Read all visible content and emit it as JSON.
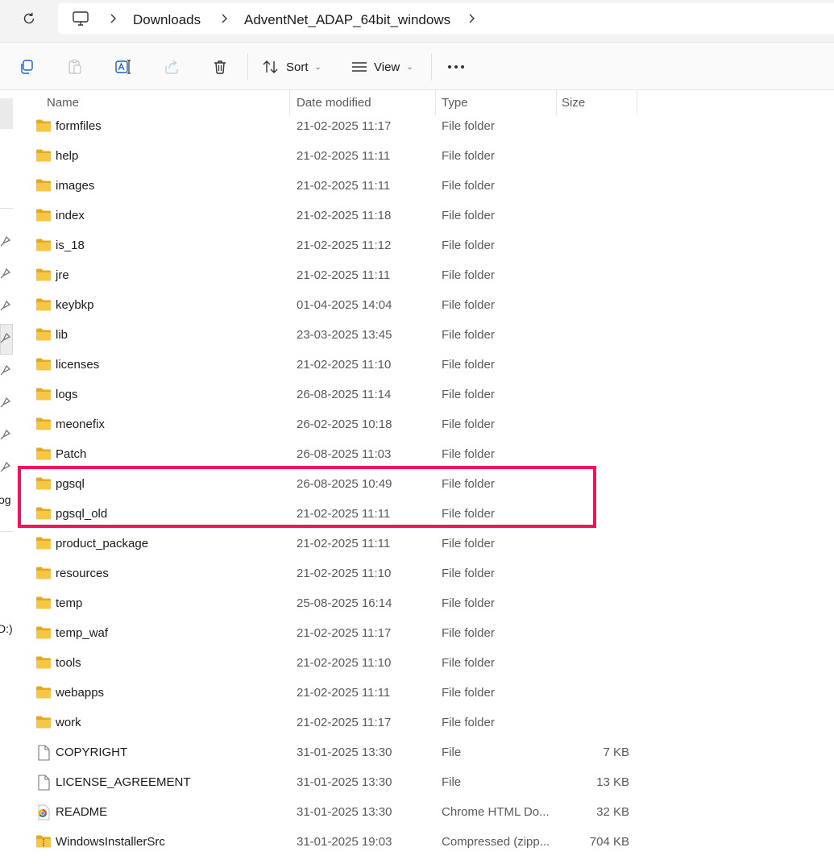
{
  "address_bar": {
    "crumbs": [
      "Downloads",
      "AdventNet_ADAP_64bit_windows"
    ]
  },
  "toolbar": {
    "sort_label": "Sort",
    "view_label": "View",
    "more_label": "•••"
  },
  "left_pane": {
    "partial_text_1": "og",
    "partial_text_2": "D:)"
  },
  "columns": {
    "name": "Name",
    "date": "Date modified",
    "type": "Type",
    "size": "Size"
  },
  "files": [
    {
      "name": "formfiles",
      "date": "21-02-2025 11:17",
      "type": "File folder",
      "size": "",
      "icon": "folder-icon"
    },
    {
      "name": "help",
      "date": "21-02-2025 11:11",
      "type": "File folder",
      "size": "",
      "icon": "folder-icon"
    },
    {
      "name": "images",
      "date": "21-02-2025 11:11",
      "type": "File folder",
      "size": "",
      "icon": "folder-icon"
    },
    {
      "name": "index",
      "date": "21-02-2025 11:18",
      "type": "File folder",
      "size": "",
      "icon": "folder-icon"
    },
    {
      "name": "is_18",
      "date": "21-02-2025 11:12",
      "type": "File folder",
      "size": "",
      "icon": "folder-icon"
    },
    {
      "name": "jre",
      "date": "21-02-2025 11:11",
      "type": "File folder",
      "size": "",
      "icon": "folder-icon"
    },
    {
      "name": "keybkp",
      "date": "01-04-2025 14:04",
      "type": "File folder",
      "size": "",
      "icon": "folder-icon"
    },
    {
      "name": "lib",
      "date": "23-03-2025 13:45",
      "type": "File folder",
      "size": "",
      "icon": "folder-icon"
    },
    {
      "name": "licenses",
      "date": "21-02-2025 11:10",
      "type": "File folder",
      "size": "",
      "icon": "folder-icon"
    },
    {
      "name": "logs",
      "date": "26-08-2025 11:14",
      "type": "File folder",
      "size": "",
      "icon": "folder-icon"
    },
    {
      "name": "meonefix",
      "date": "26-02-2025 10:18",
      "type": "File folder",
      "size": "",
      "icon": "folder-icon"
    },
    {
      "name": "Patch",
      "date": "26-08-2025 11:03",
      "type": "File folder",
      "size": "",
      "icon": "folder-icon"
    },
    {
      "name": "pgsql",
      "date": "26-08-2025 10:49",
      "type": "File folder",
      "size": "",
      "icon": "folder-icon"
    },
    {
      "name": "pgsql_old",
      "date": "21-02-2025 11:11",
      "type": "File folder",
      "size": "",
      "icon": "folder-icon"
    },
    {
      "name": "product_package",
      "date": "21-02-2025 11:11",
      "type": "File folder",
      "size": "",
      "icon": "folder-icon"
    },
    {
      "name": "resources",
      "date": "21-02-2025 11:10",
      "type": "File folder",
      "size": "",
      "icon": "folder-icon"
    },
    {
      "name": "temp",
      "date": "25-08-2025 16:14",
      "type": "File folder",
      "size": "",
      "icon": "folder-icon"
    },
    {
      "name": "temp_waf",
      "date": "21-02-2025 11:17",
      "type": "File folder",
      "size": "",
      "icon": "folder-icon"
    },
    {
      "name": "tools",
      "date": "21-02-2025 11:10",
      "type": "File folder",
      "size": "",
      "icon": "folder-icon"
    },
    {
      "name": "webapps",
      "date": "21-02-2025 11:11",
      "type": "File folder",
      "size": "",
      "icon": "folder-icon"
    },
    {
      "name": "work",
      "date": "21-02-2025 11:17",
      "type": "File folder",
      "size": "",
      "icon": "folder-icon"
    },
    {
      "name": "COPYRIGHT",
      "date": "31-01-2025 13:30",
      "type": "File",
      "size": "7 KB",
      "icon": "file-icon"
    },
    {
      "name": "LICENSE_AGREEMENT",
      "date": "31-01-2025 13:30",
      "type": "File",
      "size": "13 KB",
      "icon": "file-icon"
    },
    {
      "name": "README",
      "date": "31-01-2025 13:30",
      "type": "Chrome HTML Do...",
      "size": "32 KB",
      "icon": "chrome-html-icon"
    },
    {
      "name": "WindowsInstallerSrc",
      "date": "31-01-2025 19:03",
      "type": "Compressed (zipp...",
      "size": "704 KB",
      "icon": "zip-folder-icon"
    }
  ],
  "colors": {
    "folder": "#f7c645",
    "folder_dark": "#e6a81e",
    "highlight": "#ee1559"
  }
}
